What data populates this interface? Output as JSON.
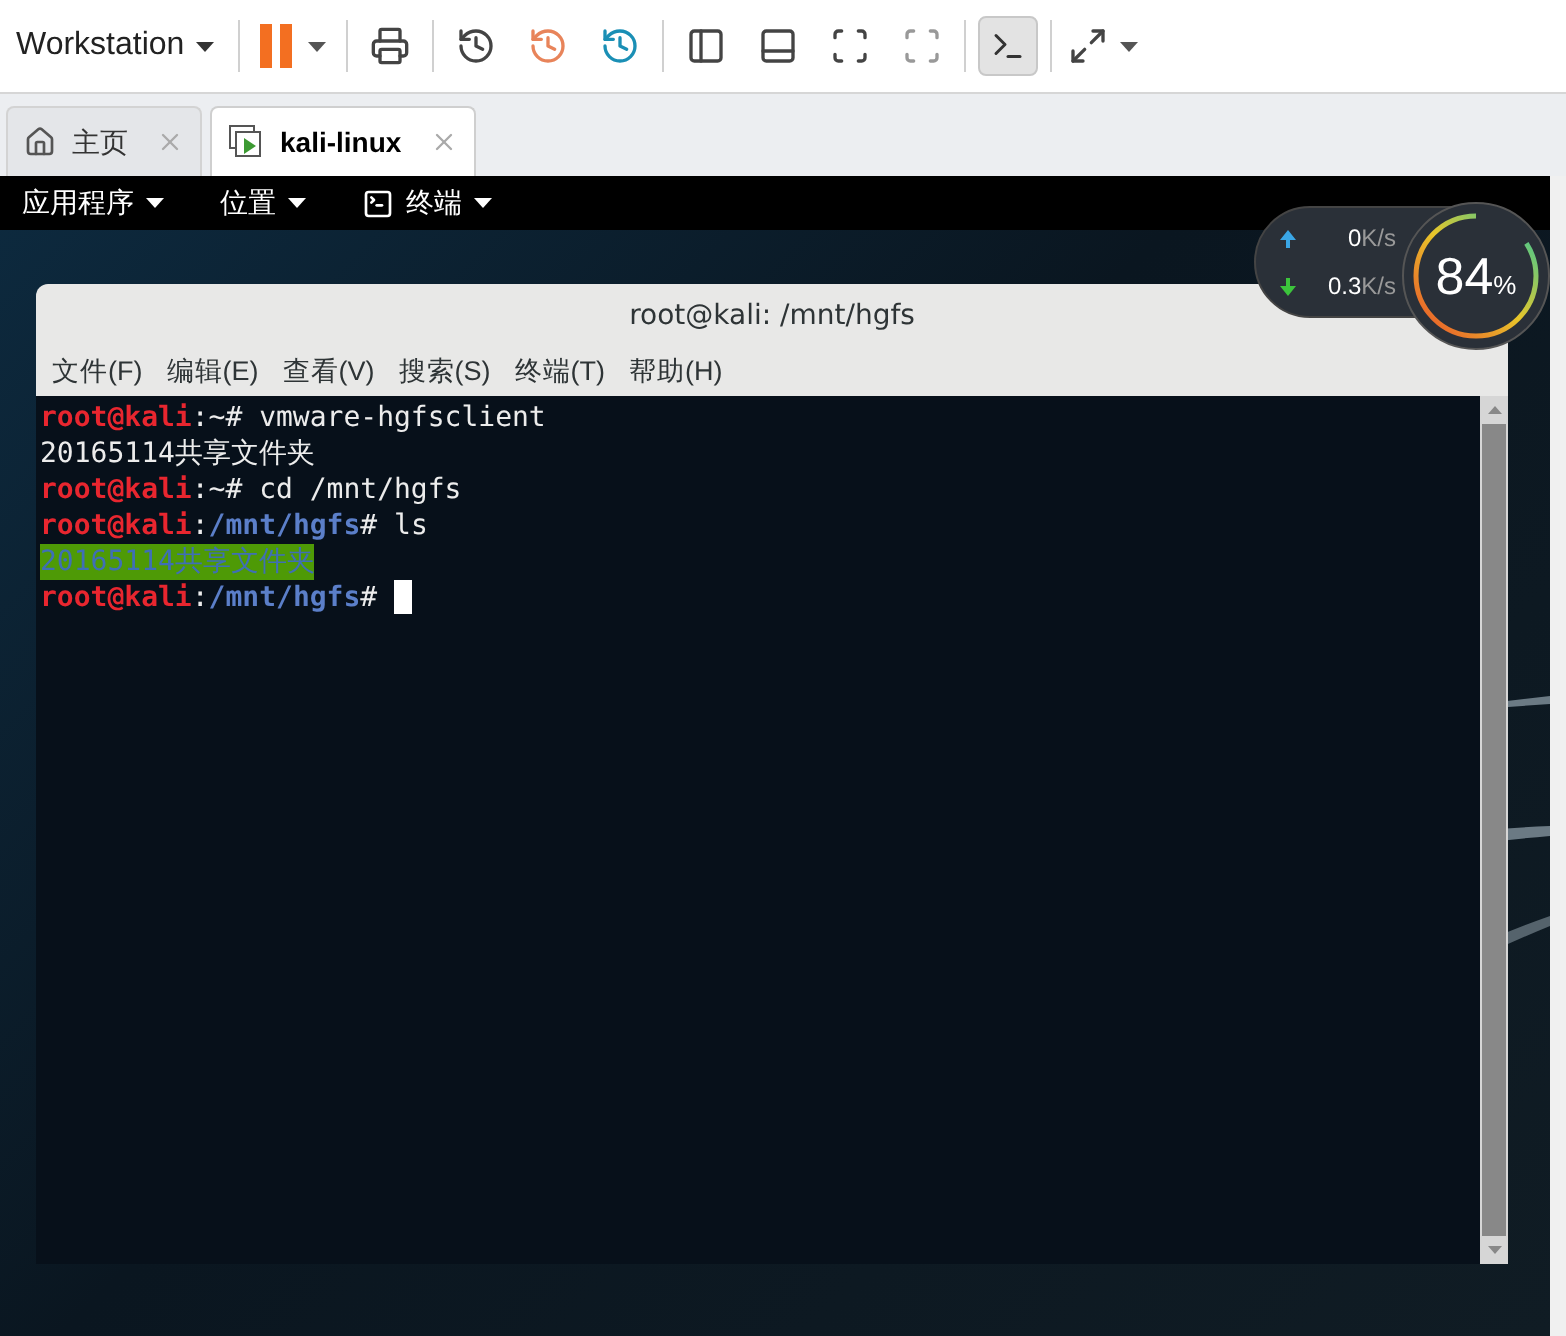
{
  "toolbar": {
    "product": "Workstation"
  },
  "tabs": [
    {
      "label": "主页",
      "kind": "home",
      "selected": false
    },
    {
      "label": "kali-linux",
      "kind": "vm",
      "selected": true
    }
  ],
  "guest_panel": {
    "menus": [
      {
        "label": "应用程序",
        "kind": "text"
      },
      {
        "label": "位置",
        "kind": "text"
      },
      {
        "label": "终端",
        "kind": "terminal"
      }
    ]
  },
  "net_widget": {
    "upload": {
      "value": "0",
      "unit": "K/s"
    },
    "download": {
      "value": "0.3",
      "unit": "K/s"
    },
    "usage": {
      "value": "84",
      "unit": "%",
      "level": 0.84
    }
  },
  "terminal": {
    "title": "root@kali: /mnt/hgfs",
    "menu": [
      "文件(F)",
      "编辑(E)",
      "查看(V)",
      "搜索(S)",
      "终端(T)",
      "帮助(H)"
    ],
    "lines": [
      {
        "segments": [
          {
            "kind": "user",
            "text": "root@kali"
          },
          {
            "kind": "plain",
            "text": ":~# vmware-hgfsclient"
          }
        ]
      },
      {
        "segments": [
          {
            "kind": "plain",
            "text": "20165114共享文件夹"
          }
        ]
      },
      {
        "segments": [
          {
            "kind": "user",
            "text": "root@kali"
          },
          {
            "kind": "plain",
            "text": ":~# cd /mnt/hgfs"
          }
        ]
      },
      {
        "segments": [
          {
            "kind": "user",
            "text": "root@kali"
          },
          {
            "kind": "plain",
            "text": ":"
          },
          {
            "kind": "path",
            "text": "/mnt/hgfs"
          },
          {
            "kind": "plain",
            "text": "# ls"
          }
        ]
      },
      {
        "segments": [
          {
            "kind": "dir",
            "text": "20165114共享文件夹"
          }
        ]
      },
      {
        "segments": [
          {
            "kind": "user",
            "text": "root@kali"
          },
          {
            "kind": "plain",
            "text": ":"
          },
          {
            "kind": "path",
            "text": "/mnt/hgfs"
          },
          {
            "kind": "plain",
            "text": "# "
          }
        ],
        "cursor": true
      }
    ]
  }
}
